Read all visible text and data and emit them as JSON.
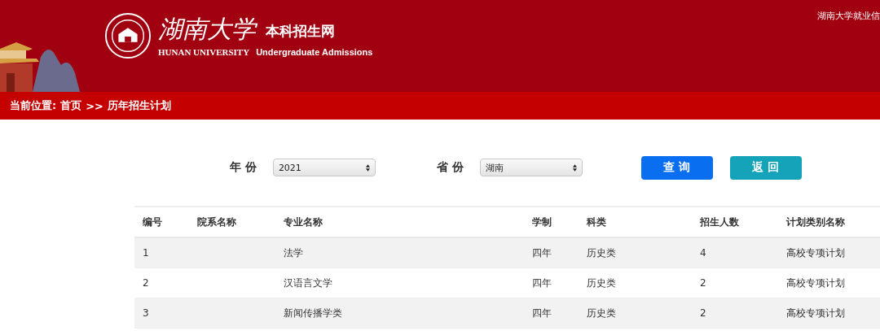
{
  "header": {
    "logo_calligraphy": "湖南大学",
    "logo_english": "HUNAN UNIVERSITY",
    "site_name": "本科招生网",
    "site_name_english": "Undergraduate Admissions",
    "top_link": "湖南大学就业信"
  },
  "breadcrumb": {
    "label": "当前位置:",
    "items": [
      "首页",
      "历年招生计划"
    ],
    "separator": ">>"
  },
  "filters": [
    {
      "label": "年 份",
      "value": "2021"
    },
    {
      "label": "省 份",
      "value": "湖南"
    }
  ],
  "buttons": [
    {
      "label": "查 询",
      "kind": "primary"
    },
    {
      "label": "返 回",
      "kind": "secondary"
    }
  ],
  "table": {
    "columns": [
      "编号",
      "院系名称",
      "专业名称",
      "学制",
      "科类",
      "招生人数",
      "计划类别名称"
    ],
    "rows": [
      [
        "1",
        "",
        "法学",
        "四年",
        "历史类",
        "4",
        "高校专项计划"
      ],
      [
        "2",
        "",
        "汉语言文学",
        "四年",
        "历史类",
        "2",
        "高校专项计划"
      ],
      [
        "3",
        "",
        "新闻传播学类",
        "四年",
        "历史类",
        "2",
        "高校专项计划"
      ]
    ]
  }
}
